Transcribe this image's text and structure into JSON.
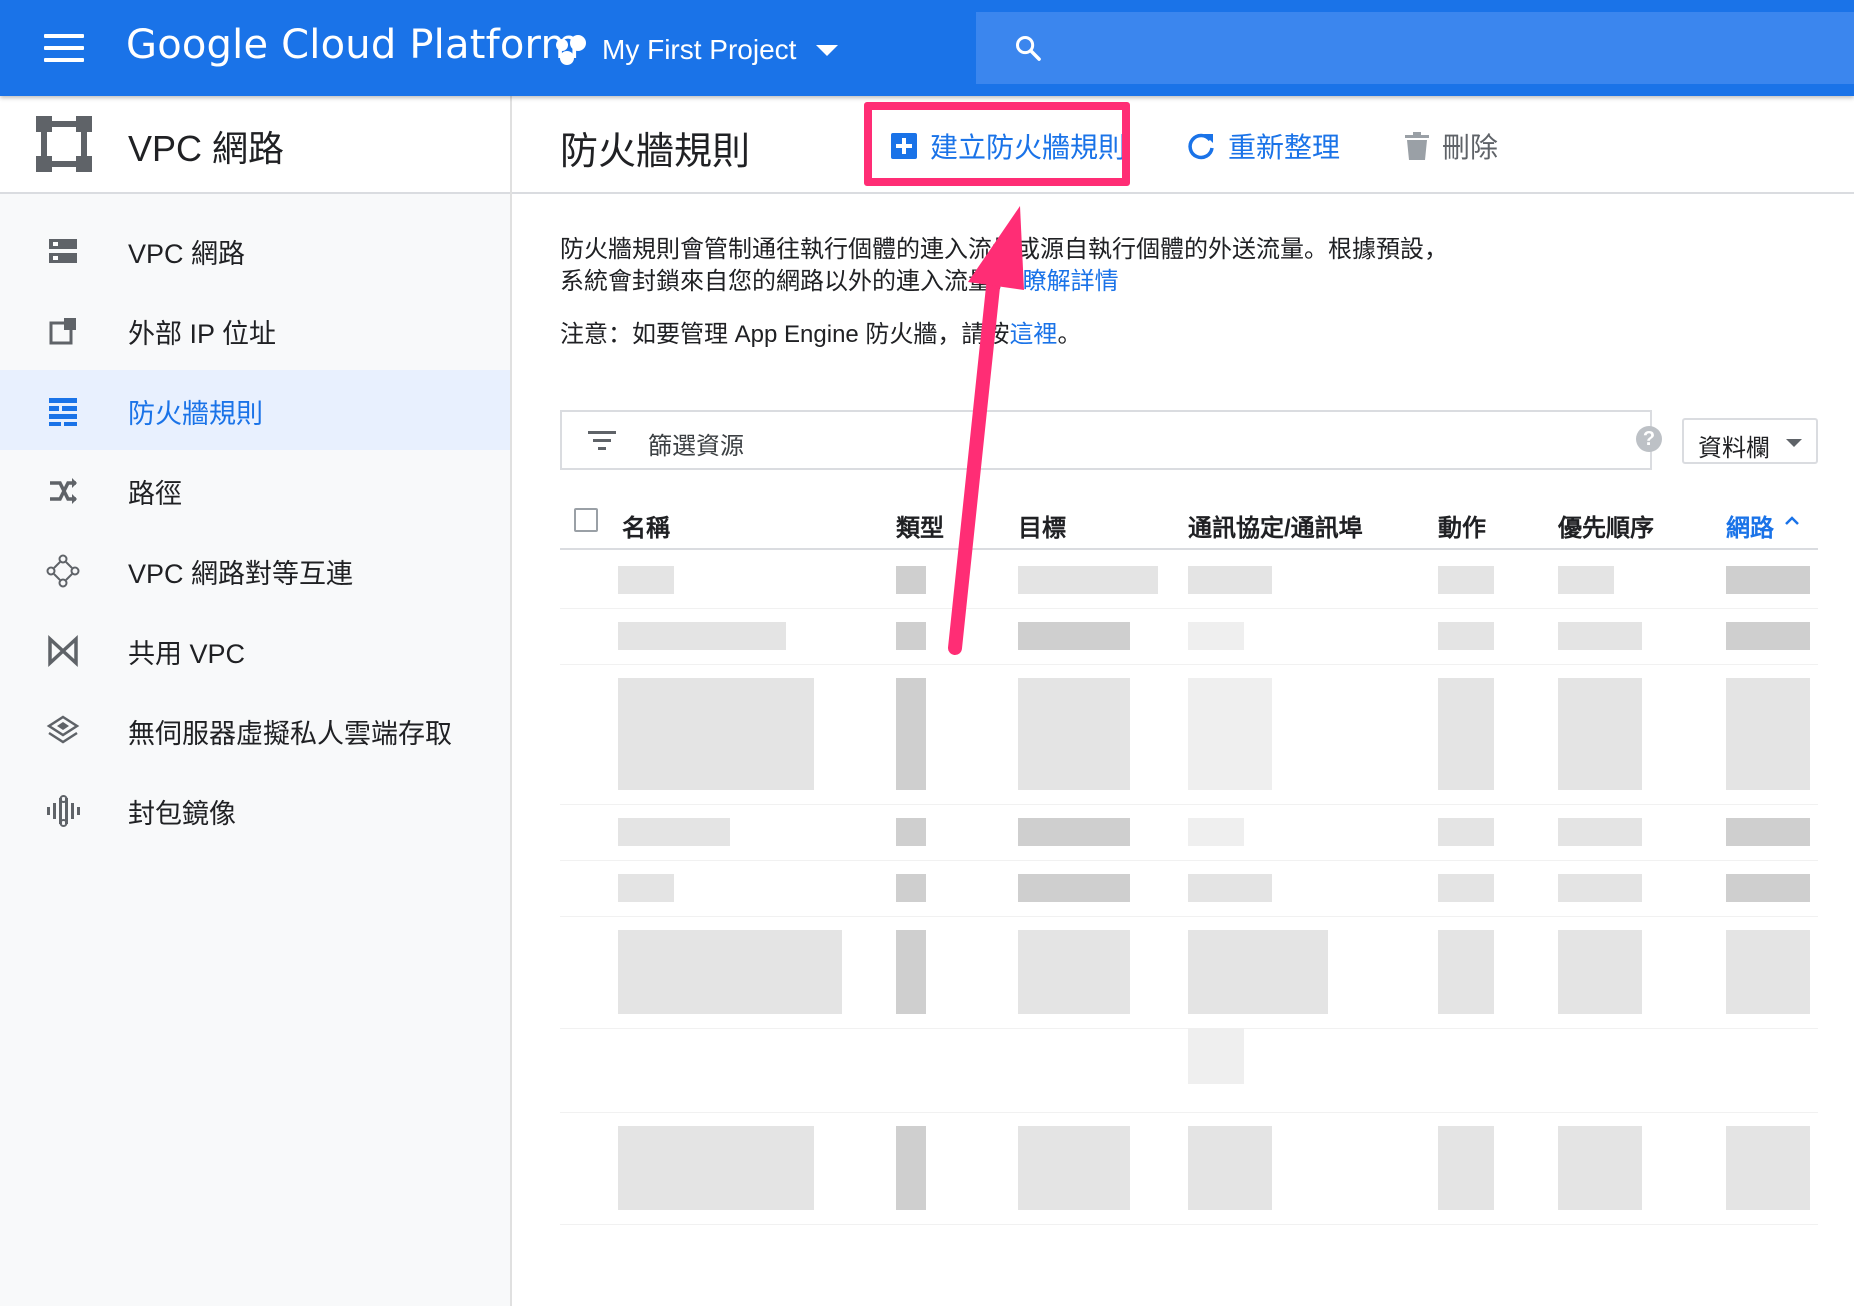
{
  "topbar": {
    "brand": "Google Cloud Platform",
    "project_name": "My First Project",
    "menu_icon": "hamburger-menu-icon",
    "search_icon": "search-icon",
    "color": "#1a73e8"
  },
  "sidebar": {
    "title": "VPC 網路",
    "items": [
      {
        "label": "VPC 網路",
        "icon": "vpc-network-icon"
      },
      {
        "label": "外部 IP 位址",
        "icon": "external-ip-icon"
      },
      {
        "label": "防火牆規則",
        "icon": "firewall-icon",
        "active": true
      },
      {
        "label": "路徑",
        "icon": "route-icon"
      },
      {
        "label": "VPC 網路對等互連",
        "icon": "peering-icon"
      },
      {
        "label": "共用 VPC",
        "icon": "shared-vpc-icon"
      },
      {
        "label": "無伺服器虛擬私人雲端存取",
        "icon": "serverless-vpc-icon"
      },
      {
        "label": "封包鏡像",
        "icon": "packet-mirroring-icon"
      }
    ]
  },
  "main": {
    "title": "防火牆規則",
    "toolbar": {
      "create_label": "建立防火牆規則",
      "refresh_label": "重新整理",
      "delete_label": "刪除"
    },
    "description": "防火牆規則會管制通往執行個體的連入流量或源自執行個體的外送流量。根據預設，系統會封鎖來自您的網路以外的連入流量。",
    "learn_more": "瞭解詳情",
    "note_prefix": "注意：如要管理 App Engine 防火牆，請按",
    "note_link": "這裡",
    "note_suffix": "。",
    "filter_placeholder": "篩選資源",
    "columns_button": "資料欄",
    "table_headers": [
      "名稱",
      "類型",
      "目標",
      "通訊協定/通訊埠",
      "動作",
      "優先順序",
      "網路"
    ],
    "highlight_color": "#ff2d75"
  }
}
